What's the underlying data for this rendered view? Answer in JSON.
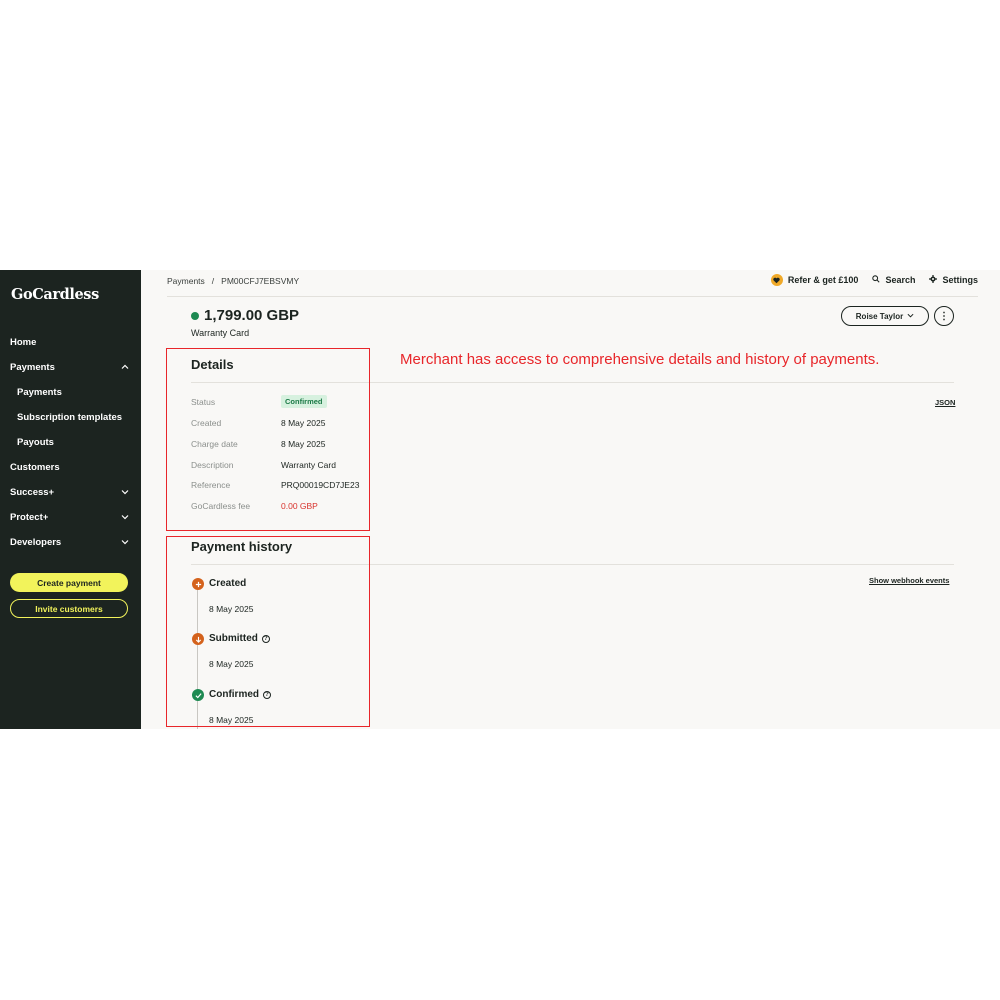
{
  "sidebar": {
    "logo": "GoCardless",
    "items": [
      {
        "label": "Home"
      },
      {
        "label": "Payments"
      },
      {
        "label": "Payments"
      },
      {
        "label": "Subscription templates"
      },
      {
        "label": "Payouts"
      },
      {
        "label": "Customers"
      },
      {
        "label": "Success+"
      },
      {
        "label": "Protect+"
      },
      {
        "label": "Developers"
      }
    ],
    "create_payment": "Create payment",
    "invite_customers": "Invite customers"
  },
  "breadcrumb": {
    "root": "Payments",
    "separator": "/",
    "current": "PM00CFJ7EBSVMY"
  },
  "topbar": {
    "refer": "Refer & get £100",
    "search": "Search",
    "settings": "Settings"
  },
  "payment": {
    "amount": "1,799.00 GBP",
    "description": "Warranty Card",
    "status_color": "#1e8a52"
  },
  "customer_button": "Roise Taylor",
  "more_button": "⋮",
  "details": {
    "title": "Details",
    "json_link": "JSON",
    "rows": [
      {
        "label": "Status",
        "value": "Confirmed"
      },
      {
        "label": "Created",
        "value": "8 May 2025"
      },
      {
        "label": "Charge date",
        "value": "8 May 2025"
      },
      {
        "label": "Description",
        "value": "Warranty Card"
      },
      {
        "label": "Reference",
        "value": "PRQ00019CD7JE23"
      },
      {
        "label": "GoCardless fee",
        "value": "0.00 GBP"
      }
    ]
  },
  "history": {
    "title": "Payment history",
    "webhook_link": "Show webhook events",
    "events": [
      {
        "title": "Created",
        "date": "8 May 2025",
        "icon": "plus-icon",
        "help": false
      },
      {
        "title": "Submitted",
        "date": "8 May 2025",
        "icon": "arrow-down-icon",
        "help": true
      },
      {
        "title": "Confirmed",
        "date": "8 May 2025",
        "icon": "check-icon",
        "help": true
      }
    ]
  },
  "annotation": {
    "text": "Merchant has access to comprehensive details and history of payments.",
    "color": "#e8262a"
  },
  "colors": {
    "sidebar_bg": "#1c2420",
    "accent_yellow": "#f2f35b",
    "status_green": "#1e8a52",
    "event_orange": "#d4621c"
  }
}
